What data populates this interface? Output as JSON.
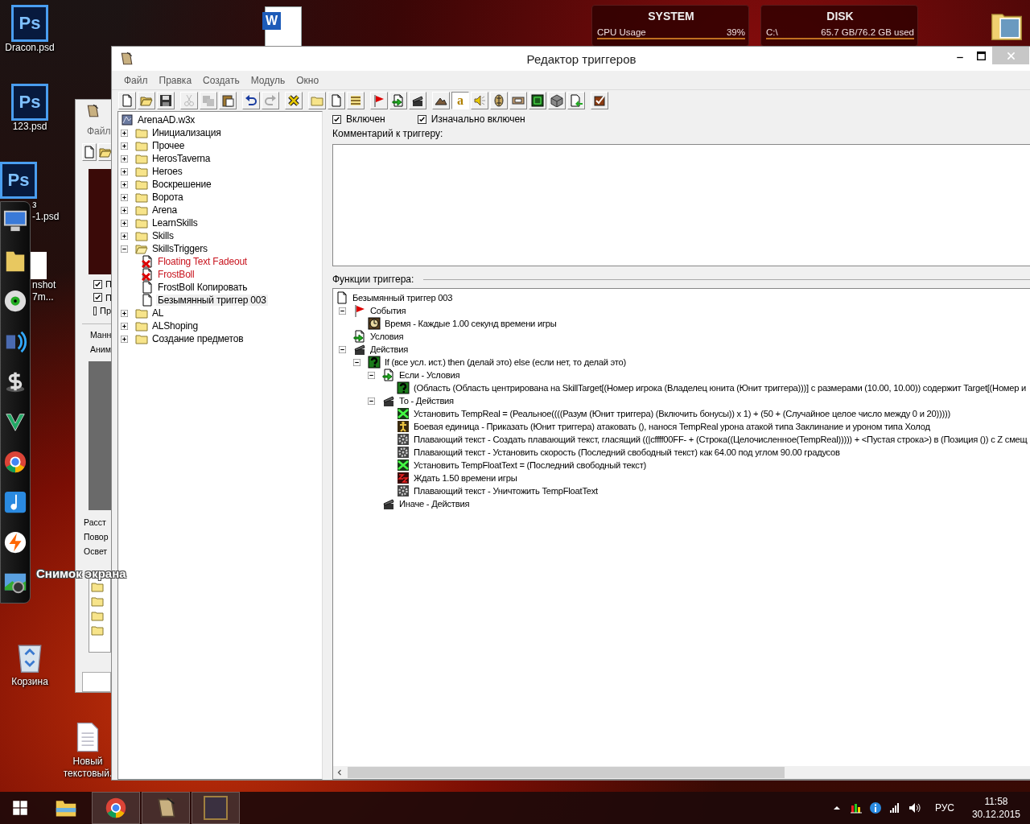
{
  "desktop": {
    "icons": [
      {
        "kind": "psd",
        "badge": "Ps",
        "label_lines": [
          "Dracon.psd"
        ]
      },
      {
        "kind": "psd",
        "badge": "Ps",
        "label_lines": [
          "123.psd"
        ]
      },
      {
        "kind": "psd",
        "badge": "Ps",
        "label_lines": [
          "з",
          "-1.psd"
        ]
      },
      {
        "kind": "image",
        "label_lines": [
          "nshot",
          "7m..."
        ]
      },
      {
        "kind": "word",
        "badge": "W"
      },
      {
        "kind": "folder"
      },
      {
        "kind": "recycle-bin",
        "label_lines": [
          "Корзина"
        ]
      },
      {
        "kind": "text-file",
        "label_lines": [
          "Новый",
          "текстовый."
        ]
      }
    ]
  },
  "dock": {
    "items": [
      {
        "kind": "monitor"
      },
      {
        "kind": "folder"
      },
      {
        "kind": "disc"
      },
      {
        "kind": "speaker"
      },
      {
        "kind": "dollar"
      },
      {
        "kind": "chevron"
      },
      {
        "kind": "browser"
      },
      {
        "kind": "note"
      },
      {
        "kind": "bolt"
      },
      {
        "kind": "camera"
      }
    ],
    "tooltip": "Снимок экрана"
  },
  "widgets": [
    {
      "title": "SYSTEM",
      "label": "CPU Usage",
      "value": "39%"
    },
    {
      "title": "DISK",
      "label": "C:\\",
      "value": "65.7 GB/76.2 GB used"
    }
  ],
  "back_window": {
    "menu": [
      "Файл"
    ],
    "checkboxes": [
      {
        "label": "П",
        "checked": true
      },
      {
        "label": "П",
        "checked": true
      },
      {
        "label": "Пр",
        "checked": false
      }
    ],
    "group_labels": [
      "Манн",
      "Аним"
    ],
    "labels": [
      "Расст",
      "Повор",
      "Освет"
    ]
  },
  "window": {
    "title": "Редактор триггеров",
    "menu": [
      "Файл",
      "Правка",
      "Создать",
      "Модуль",
      "Окно"
    ],
    "toolbar": [
      [
        {
          "kind": "doc",
          "disabled": false
        },
        {
          "kind": "open",
          "disabled": false
        },
        {
          "kind": "save",
          "disabled": false
        }
      ],
      [
        {
          "kind": "cut",
          "disabled": true
        },
        {
          "kind": "copy",
          "disabled": true
        },
        {
          "kind": "paste",
          "disabled": false
        }
      ],
      [
        {
          "kind": "undo",
          "disabled": false
        },
        {
          "kind": "redo",
          "disabled": true
        }
      ],
      [
        {
          "kind": "xmark",
          "disabled": false
        }
      ],
      [
        {
          "kind": "folder",
          "disabled": false
        },
        {
          "kind": "doc",
          "disabled": false
        },
        {
          "kind": "list",
          "disabled": false
        }
      ],
      [
        {
          "kind": "flag",
          "disabled": false
        },
        {
          "kind": "cond",
          "disabled": false
        },
        {
          "kind": "clapper",
          "disabled": false
        }
      ],
      [
        {
          "kind": "mountain",
          "disabled": false
        },
        {
          "kind": "text",
          "label": "a",
          "disabled": false,
          "selected": true
        },
        {
          "kind": "speaker",
          "disabled": false
        },
        {
          "kind": "ornament",
          "disabled": false
        },
        {
          "kind": "tile",
          "disabled": false
        },
        {
          "kind": "grid",
          "disabled": false
        },
        {
          "kind": "cube",
          "disabled": false
        },
        {
          "kind": "import",
          "disabled": false
        }
      ],
      [
        {
          "kind": "check",
          "disabled": false
        }
      ]
    ],
    "map_tree": {
      "label": "ArenaAD.w3x",
      "children": [
        {
          "kind": "folder",
          "label": "Инициализация",
          "expanded": false
        },
        {
          "kind": "folder",
          "label": "Прочее",
          "expanded": false
        },
        {
          "kind": "folder",
          "label": "HerosTaverna",
          "expanded": false
        },
        {
          "kind": "folder",
          "label": "Heroes",
          "expanded": false
        },
        {
          "kind": "folder",
          "label": "Воскрешение",
          "expanded": false
        },
        {
          "kind": "folder",
          "label": "Ворота",
          "expanded": false
        },
        {
          "kind": "folder",
          "label": "Arena",
          "expanded": false
        },
        {
          "kind": "folder",
          "label": "LearnSkills",
          "expanded": false
        },
        {
          "kind": "folder",
          "label": "Skills",
          "expanded": false
        },
        {
          "kind": "folder",
          "label": "SkillsTriggers",
          "expanded": true,
          "children": [
            {
              "kind": "trigger",
              "label": "Floating Text Fadeout",
              "disabled": true,
              "selected": false
            },
            {
              "kind": "trigger",
              "label": "FrostBoll",
              "disabled": true,
              "selected": false
            },
            {
              "kind": "trigger",
              "label": "FrostBoll Копировать",
              "disabled": false,
              "selected": false
            },
            {
              "kind": "trigger",
              "label": "Безымянный триггер 003",
              "disabled": false,
              "selected": true
            }
          ]
        },
        {
          "kind": "folder",
          "label": "AL",
          "expanded": false
        },
        {
          "kind": "folder",
          "label": "ALShoping",
          "expanded": false
        },
        {
          "kind": "folder",
          "label": "Создание предметов",
          "expanded": false
        }
      ]
    },
    "enabled": {
      "label": "Включен",
      "checked": true
    },
    "initially_on": {
      "label": "Изначально включен",
      "checked": true
    },
    "comment_label": "Комментарий к триггеру:",
    "functions_label": "Функции триггера:",
    "functions": {
      "kind": "doc",
      "label": "Безымянный триггер 003",
      "children": [
        {
          "kind": "flag",
          "label": "События",
          "expanded": true,
          "children": [
            {
              "kind": "clock",
              "label": "Время - Каждые 1.00 секунд времени игры"
            }
          ]
        },
        {
          "kind": "cond",
          "label": "Условия"
        },
        {
          "kind": "clapper",
          "label": "Действия",
          "expanded": true,
          "children": [
            {
              "kind": "question",
              "label": "If (все усл. ист.) then (делай это) else (если нет, то делай это)",
              "expanded": true,
              "children": [
                {
                  "kind": "cond",
                  "label": "Если - Условия",
                  "expanded": true,
                  "children": [
                    {
                      "kind": "question",
                      "label": "(Область (Область центрирована на SkillTarget[(Номер игрока (Владелец юнита (Юнит триггера)))] с размерами (10.00, 10.00)) содержит Target[(Номер и"
                    }
                  ]
                },
                {
                  "kind": "clapper",
                  "label": "То - Действия",
                  "expanded": true,
                  "children": [
                    {
                      "kind": "set",
                      "label": "Установить TempReal = (Реальное((((Разум (Юнит триггера) (Включить бонусы)) x 1) + (50 + (Случайное целое число между 0 и 20)))))"
                    },
                    {
                      "kind": "unit",
                      "label": "Боевая единица - Приказать (Юнит триггера) атаковать (), нанося TempReal урона атакой типа Заклинание и уроном типа Холод"
                    },
                    {
                      "kind": "gear",
                      "label": "Плавающий текст - Создать плавающий текст, гласящий ((|cffff00FF- + (Строка((Целочисленное(TempReal))))) + <Пустая строка>) в (Позиция ()) с Z смещ"
                    },
                    {
                      "kind": "gear",
                      "label": "Плавающий текст - Установить скорость (Последний свободный текст) как 64.00 под углом 90.00 градусов"
                    },
                    {
                      "kind": "set",
                      "label": "Установить TempFloatText = (Последний свободный текст)"
                    },
                    {
                      "kind": "wait",
                      "label": "Ждать 1.50 времени игры"
                    },
                    {
                      "kind": "gear",
                      "label": "Плавающий текст - Уничтожить TempFloatText"
                    }
                  ]
                },
                {
                  "kind": "clapper",
                  "label": "Иначе - Действия"
                }
              ]
            }
          ]
        }
      ]
    }
  },
  "taskbar": {
    "apps": [
      {
        "kind": "explorer",
        "active": false
      },
      {
        "kind": "browser",
        "active": true
      },
      {
        "kind": "scroll",
        "active": true
      },
      {
        "kind": "portrait",
        "active": true
      }
    ],
    "tray": [
      {
        "kind": "caret"
      },
      {
        "kind": "chart"
      },
      {
        "kind": "info"
      },
      {
        "kind": "signal"
      },
      {
        "kind": "volume"
      }
    ],
    "language": "РУС",
    "time": "11:58",
    "date": "30.12.2015"
  }
}
